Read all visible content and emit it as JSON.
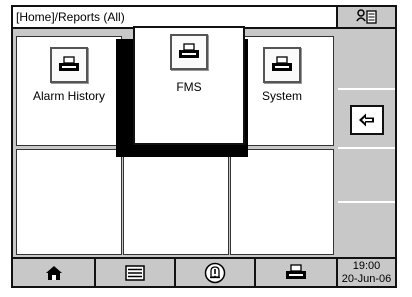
{
  "header": {
    "breadcrumb": "[Home]/Reports (All)",
    "user_icon": "user-list-icon"
  },
  "reports": [
    {
      "label": "Alarm History",
      "icon": "printer-icon"
    },
    {
      "label": "FMS",
      "icon": "printer-icon"
    },
    {
      "label": "System",
      "icon": "printer-icon"
    }
  ],
  "side": {
    "back_icon": "back-arrow-icon"
  },
  "bottom": {
    "home_icon": "home-icon",
    "list_icon": "list-icon",
    "alarm_icon": "alarm-bell-icon",
    "print_icon": "printer-icon",
    "time": "19:00",
    "date": "20-Jun-06"
  },
  "colors": {
    "panel": "#c8c8c8",
    "tile": "#ffffff",
    "border": "#111111"
  }
}
